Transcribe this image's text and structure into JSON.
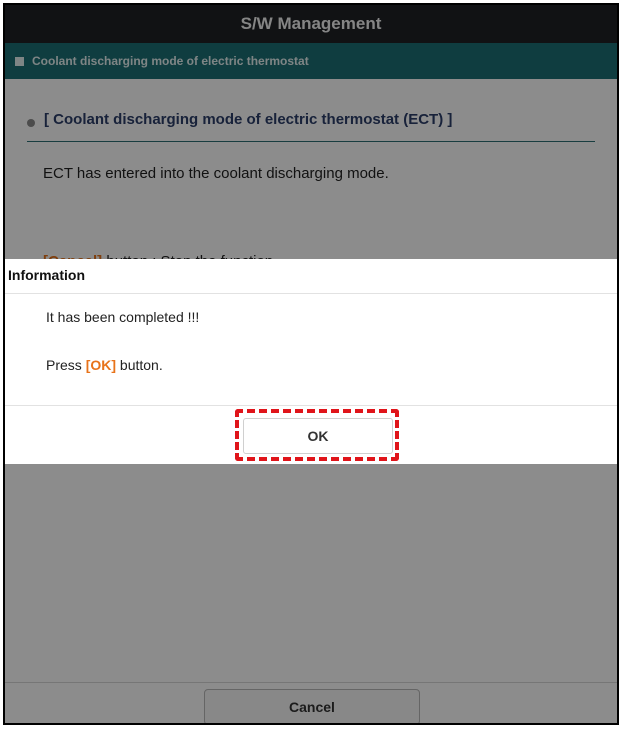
{
  "window": {
    "title": "S/W Management"
  },
  "section": {
    "title": "Coolant discharging mode of electric thermostat"
  },
  "content": {
    "heading": "[ Coolant discharging mode of electric thermostat (ECT) ]",
    "description": "ECT has entered into the coolant discharging mode.",
    "hint_prefix": "[Cancel]",
    "hint_text": " button : Stop the function."
  },
  "footer": {
    "cancel_label": "Cancel"
  },
  "dialog": {
    "title": "Information",
    "message": "It has been completed !!!",
    "press_prefix": "Press ",
    "press_highlight": "[OK]",
    "press_suffix": " button.",
    "ok_label": "OK"
  },
  "colors": {
    "title_bar": "#1f2226",
    "section_bar": "#1c6f76",
    "accent_orange": "#e8731a",
    "highlight_red": "#e0141a"
  }
}
